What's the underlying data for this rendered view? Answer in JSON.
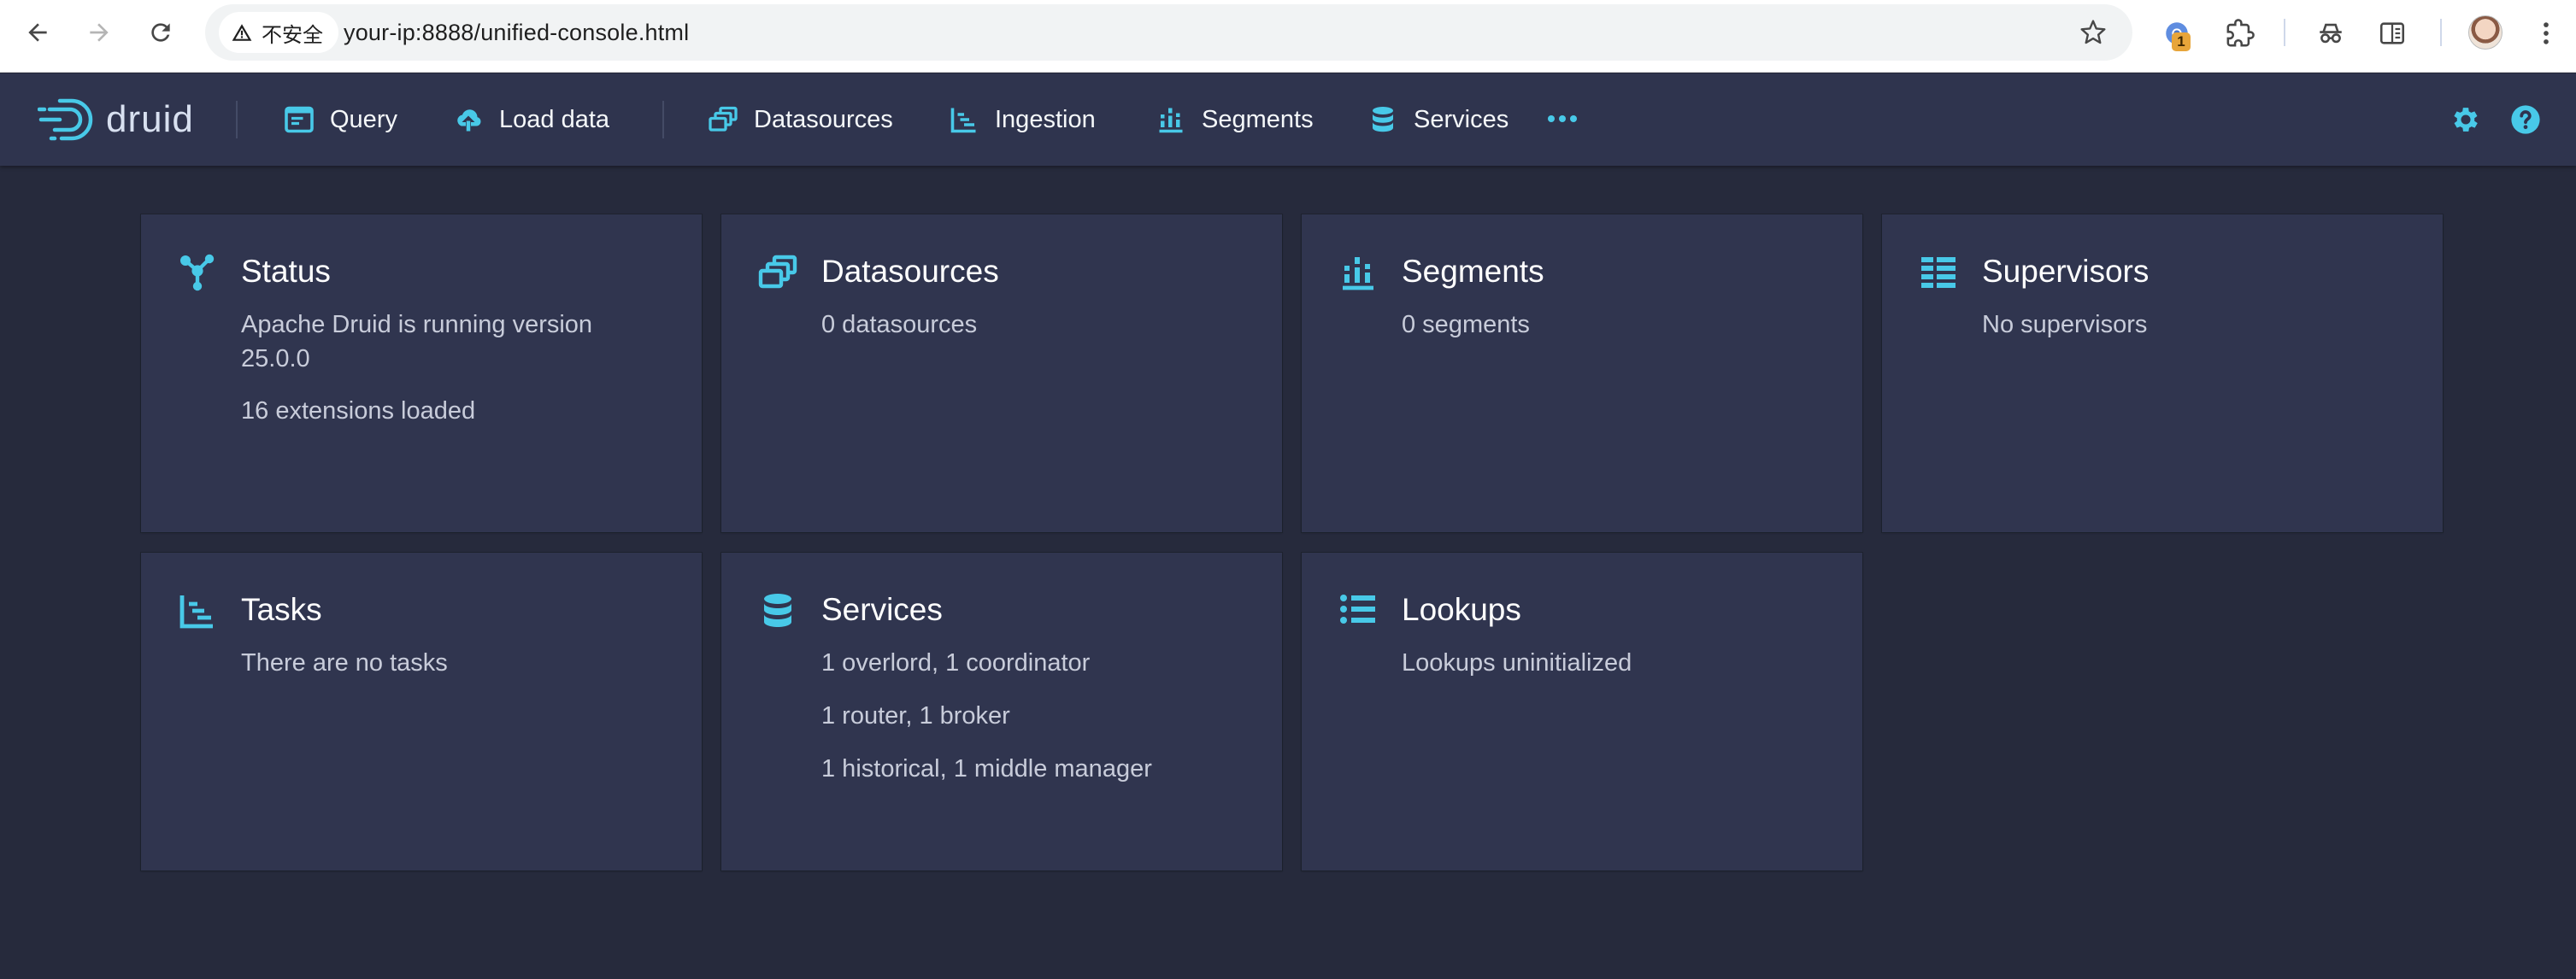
{
  "browser": {
    "security_label": "不安全",
    "url": "your-ip:8888/unified-console.html",
    "extension_badge": "1"
  },
  "navbar": {
    "logo_text": "druid",
    "items": [
      {
        "label": "Query",
        "icon": "query-icon"
      },
      {
        "label": "Load data",
        "icon": "cloud-upload-icon"
      },
      {
        "label": "Datasources",
        "icon": "datasources-icon"
      },
      {
        "label": "Ingestion",
        "icon": "ingestion-icon"
      },
      {
        "label": "Segments",
        "icon": "segments-icon"
      },
      {
        "label": "Services",
        "icon": "database-icon"
      }
    ],
    "accent_color": "#48c9e8"
  },
  "cards": {
    "status": {
      "title": "Status",
      "lines": [
        "Apache Druid is running version",
        "25.0.0",
        "16 extensions loaded"
      ]
    },
    "datasources": {
      "title": "Datasources",
      "lines": [
        "0 datasources"
      ]
    },
    "segments": {
      "title": "Segments",
      "lines": [
        "0 segments"
      ]
    },
    "supervisors": {
      "title": "Supervisors",
      "lines": [
        "No supervisors"
      ]
    },
    "tasks": {
      "title": "Tasks",
      "lines": [
        "There are no tasks"
      ]
    },
    "services": {
      "title": "Services",
      "lines": [
        "1 overlord, 1 coordinator",
        "1 router, 1 broker",
        "1 historical, 1 middle manager"
      ]
    },
    "lookups": {
      "title": "Lookups",
      "lines": [
        "Lookups uninitialized"
      ]
    }
  }
}
